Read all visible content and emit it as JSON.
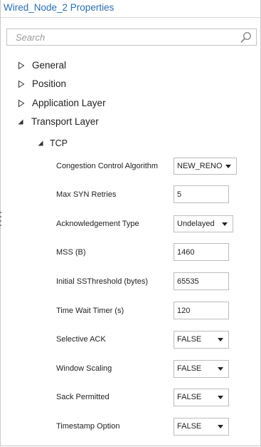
{
  "window": {
    "title": "Wired_Node_2 Properties"
  },
  "search": {
    "placeholder": "Search",
    "value": ""
  },
  "tree": {
    "general": "General",
    "position": "Position",
    "application_layer": "Application Layer",
    "transport_layer": "Transport Layer",
    "tcp": "TCP"
  },
  "tcp_properties": {
    "congestion_control_algorithm": {
      "label": "Congestion Control Algorithm",
      "value": "NEW_RENO"
    },
    "max_syn_retries": {
      "label": "Max SYN Retries",
      "value": "5"
    },
    "acknowledgement_type": {
      "label": "Acknowledgement Type",
      "value": "Undelayed"
    },
    "mss": {
      "label": "MSS (B)",
      "value": "1460"
    },
    "initial_ssthreshold": {
      "label": "Initial SSThreshold (bytes)",
      "value": "65535"
    },
    "time_wait_timer": {
      "label": "Time Wait Timer (s)",
      "value": "120"
    },
    "selective_ack": {
      "label": "Selective ACK",
      "value": "FALSE"
    },
    "window_scaling": {
      "label": "Window Scaling",
      "value": "FALSE"
    },
    "sack_permitted": {
      "label": "Sack Permitted",
      "value": "FALSE"
    },
    "timestamp_option": {
      "label": "Timestamp Option",
      "value": "FALSE"
    }
  },
  "icons": {
    "search": "search-icon",
    "collapsed": "triangle-right-icon",
    "expanded": "triangle-down-right-icon",
    "dropdown": "chevron-down-icon"
  },
  "colors": {
    "title": "#2a6fb0",
    "border": "#bdbdbd"
  }
}
